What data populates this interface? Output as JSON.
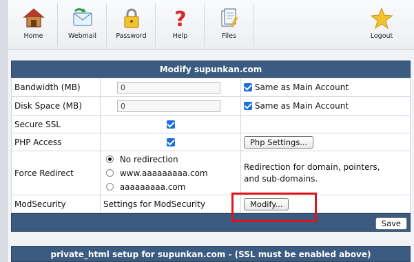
{
  "toolbar": {
    "items": [
      {
        "label": "Home",
        "icon": "home-icon"
      },
      {
        "label": "Webmail",
        "icon": "webmail-icon"
      },
      {
        "label": "Password",
        "icon": "lock-icon"
      },
      {
        "label": "Help",
        "icon": "help-icon"
      },
      {
        "label": "Files",
        "icon": "files-icon"
      },
      {
        "label": "Logout",
        "icon": "logout-star-icon"
      }
    ]
  },
  "panel": {
    "title": "Modify supunkan.com",
    "rows": {
      "bandwidth": {
        "label": "Bandwidth (MB)",
        "value": "0",
        "same_label": "Same as Main Account",
        "same_checked": true
      },
      "disk": {
        "label": "Disk Space (MB)",
        "value": "0",
        "same_label": "Same as Main Account",
        "same_checked": true
      },
      "ssl": {
        "label": "Secure SSL",
        "checked": true
      },
      "php": {
        "label": "PHP Access",
        "checked": true,
        "button": "Php Settings..."
      },
      "redirect": {
        "label": "Force Redirect",
        "options": [
          "No redirection",
          "www.aaaaaaaaa.com",
          "aaaaaaaaa.com"
        ],
        "selected": "No redirection",
        "note": "Redirection for domain, pointers, and sub-domains."
      },
      "modsec": {
        "label": "ModSecurity",
        "desc": "Settings for ModSecurity",
        "button": "Modify..."
      }
    },
    "save_label": "Save"
  },
  "panel2": {
    "title": "private_html setup for supunkan.com - (SSL must be enabled above)"
  },
  "colors": {
    "header_bar": "#3b5b80",
    "highlight": "#e0141b",
    "checkbox": "#1b6fe0"
  }
}
